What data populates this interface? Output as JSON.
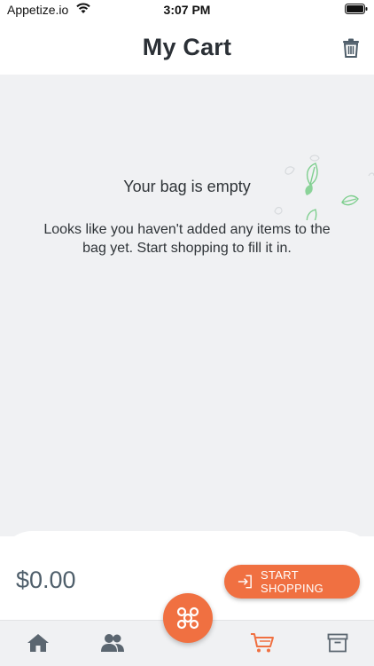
{
  "status_bar": {
    "carrier": "Appetize.io",
    "time": "3:07 PM"
  },
  "header": {
    "title": "My Cart",
    "action_icon": "trash-icon"
  },
  "empty_state": {
    "title": "Your bag is empty",
    "message": "Looks like you haven't added any items to the bag yet. Start shopping to fill it in.",
    "decoration_icon": "leaves-icon"
  },
  "summary": {
    "total": "$0.00",
    "cta_label": "START SHOPPING",
    "cta_icon": "login-arrow-icon"
  },
  "tab_bar": {
    "items": [
      {
        "name": "home",
        "icon": "home-icon",
        "active": false
      },
      {
        "name": "people",
        "icon": "people-icon",
        "active": false
      },
      {
        "name": "cart",
        "icon": "cart-icon",
        "active": true
      },
      {
        "name": "orders",
        "icon": "archive-box-icon",
        "active": false
      }
    ],
    "fab_icon": "network-nodes-icon"
  },
  "colors": {
    "accent": "#f07041",
    "tab_inactive": "#5b6670",
    "leaf": "#7fcf8f",
    "background_gray": "#f0f1f3"
  }
}
